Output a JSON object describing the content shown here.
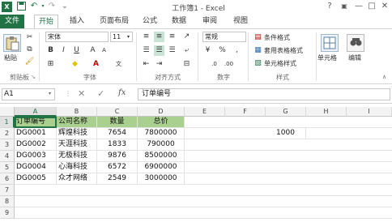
{
  "window": {
    "title": "工作簿1 - Excel",
    "logo": "X",
    "controls": [
      "?",
      "▣",
      "—",
      "□",
      "✕"
    ]
  },
  "quick_access": [
    "save-icon",
    "undo-icon",
    "redo-icon",
    "customize-icon"
  ],
  "tabs": [
    "文件",
    "开始",
    "插入",
    "页面布局",
    "公式",
    "数据",
    "审阅",
    "视图"
  ],
  "ribbon": {
    "clipboard": {
      "paste_label": "粘贴",
      "group_label": "剪贴板"
    },
    "font": {
      "font_name": "宋体",
      "font_size": "11",
      "group_label": "字体"
    },
    "alignment": {
      "group_label": "对齐方式"
    },
    "number": {
      "format": "常规",
      "group_label": "数字"
    },
    "styles": {
      "conditional_format": "条件格式",
      "table_format": "套用表格格式",
      "cell_styles": "单元格样式",
      "group_label": "样式"
    },
    "cells": {
      "label": "单元格"
    },
    "editing": {
      "label": "编辑"
    }
  },
  "formula_bar": {
    "name_box": "A1",
    "fx": "fx",
    "content": "订单编号"
  },
  "sheet": {
    "columns": [
      "A",
      "B",
      "C",
      "D",
      "E",
      "F",
      "G",
      "H",
      "I"
    ],
    "rows": [
      "1",
      "2",
      "3",
      "4",
      "5",
      "6",
      "7",
      "8",
      "9",
      "10"
    ],
    "header": [
      "订单编号",
      "公司名称",
      "数量",
      "总价"
    ],
    "data": [
      [
        "DG0001",
        "辉煌科技",
        "7654",
        "7800000"
      ],
      [
        "DG0002",
        "天涯科技",
        "1833",
        "790000"
      ],
      [
        "DG0003",
        "无极科技",
        "9876",
        "8500000"
      ],
      [
        "DG0004",
        "心海科技",
        "6572",
        "6900000"
      ],
      [
        "DG0005",
        "众才网络",
        "2549",
        "3000000"
      ]
    ],
    "g2_value": "1000"
  },
  "colors": {
    "brand": "#217346",
    "header_fill": "#a9d08e"
  }
}
